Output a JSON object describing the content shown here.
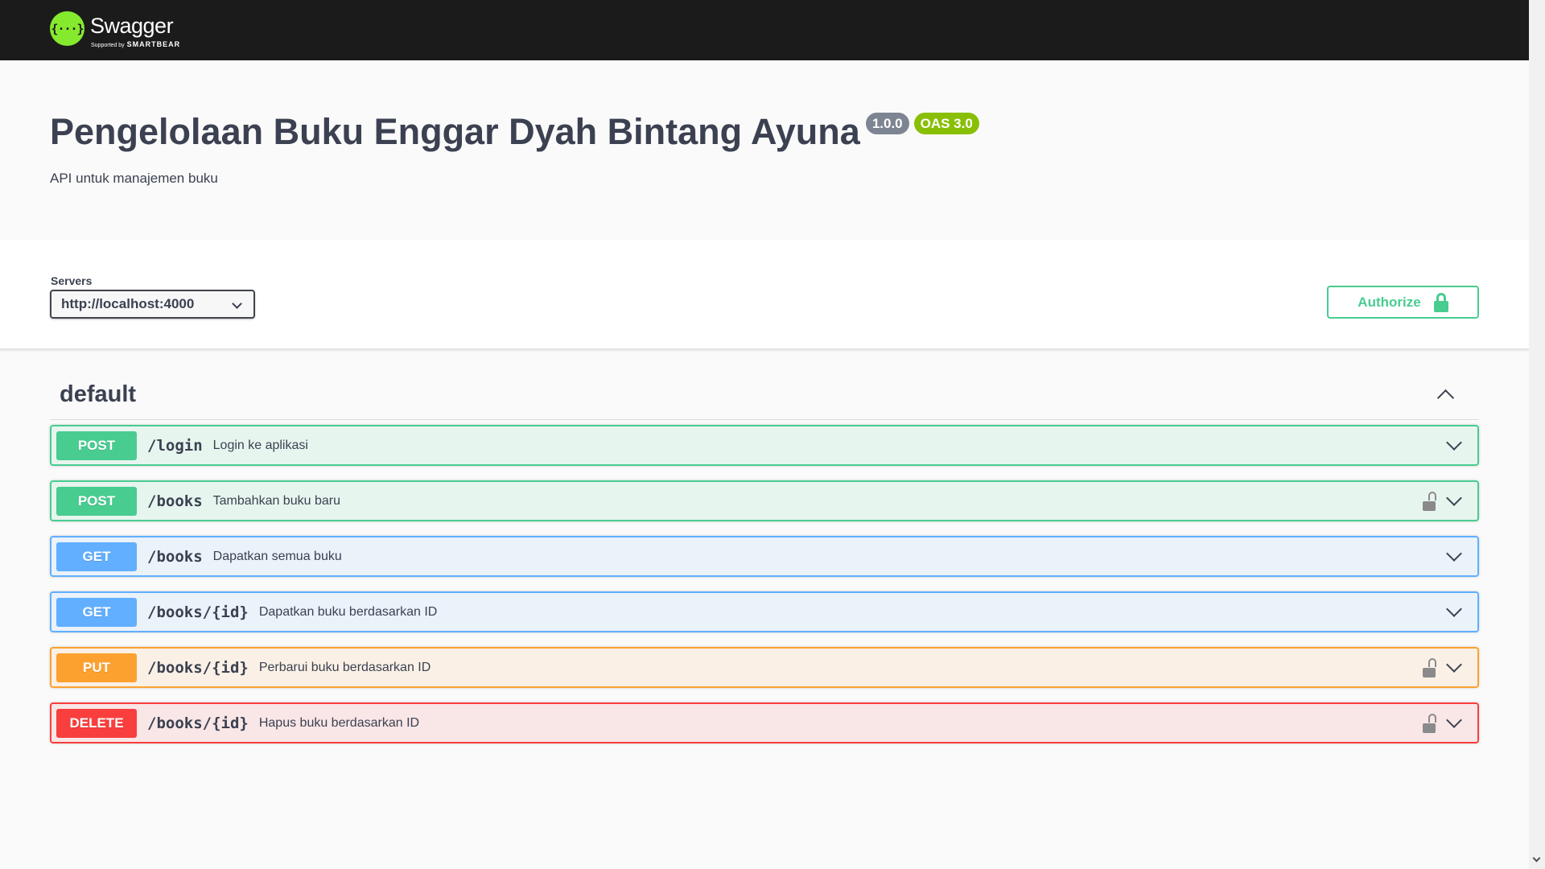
{
  "topbar": {
    "logo_mark": "{···}",
    "logo_title": "Swagger",
    "logo_sub_prefix": "Supported by",
    "logo_sub_brand": "SMARTBEAR"
  },
  "info": {
    "title": "Pengelolaan Buku Enggar Dyah Bintang Ayuna",
    "version": "1.0.0",
    "oas": "OAS 3.0",
    "description": "API untuk manajemen buku"
  },
  "servers": {
    "label": "Servers",
    "selected": "http://localhost:4000"
  },
  "authorize": {
    "label": "Authorize"
  },
  "tag": {
    "name": "default"
  },
  "operations": [
    {
      "method": "POST",
      "path": "/login",
      "summary": "Login ke aplikasi",
      "locked": false
    },
    {
      "method": "POST",
      "path": "/books",
      "summary": "Tambahkan buku baru",
      "locked": true
    },
    {
      "method": "GET",
      "path": "/books",
      "summary": "Dapatkan semua buku",
      "locked": false
    },
    {
      "method": "GET",
      "path": "/books/{id}",
      "summary": "Dapatkan buku berdasarkan ID",
      "locked": false
    },
    {
      "method": "PUT",
      "path": "/books/{id}",
      "summary": "Perbarui buku berdasarkan ID",
      "locked": true
    },
    {
      "method": "DELETE",
      "path": "/books/{id}",
      "summary": "Hapus buku berdasarkan ID",
      "locked": true
    }
  ],
  "colors": {
    "post": "#49cc90",
    "get": "#61affe",
    "put": "#fca130",
    "delete": "#f93e3e",
    "topbar": "#1b1b1b",
    "logo": "#85ea2d"
  }
}
